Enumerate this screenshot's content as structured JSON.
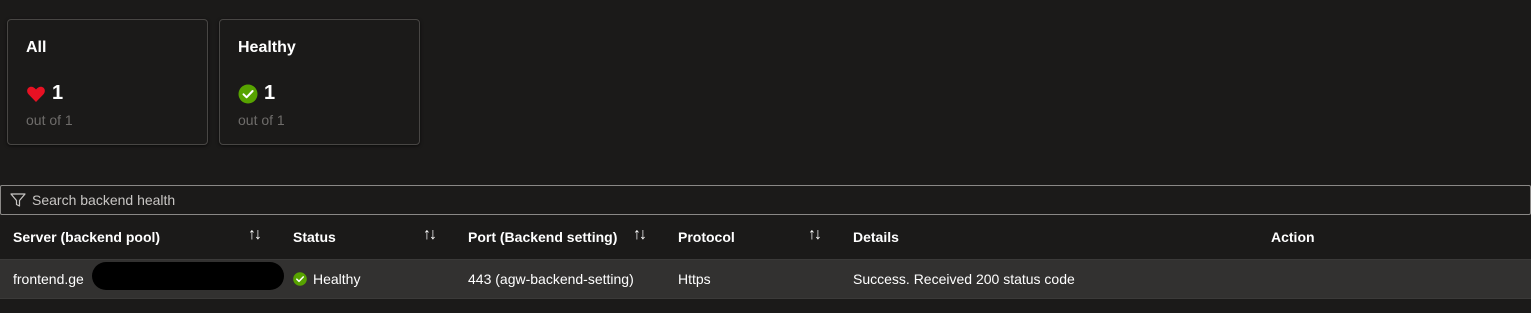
{
  "cards": [
    {
      "title": "All",
      "icon": "heart-icon",
      "count": "1",
      "sub": "out of 1"
    },
    {
      "title": "Healthy",
      "icon": "check-circle-icon",
      "count": "1",
      "sub": "out of 1"
    }
  ],
  "search": {
    "placeholder": "Search backend health",
    "value": ""
  },
  "table": {
    "headers": {
      "server": "Server (backend pool)",
      "status": "Status",
      "port": "Port (Backend setting)",
      "protocol": "Protocol",
      "details": "Details",
      "action": "Action"
    },
    "sort_glyph": "↑↓",
    "rows": [
      {
        "server": "frontend.ge",
        "status": "Healthy",
        "port": "443 (agw-backend-setting)",
        "protocol": "Https",
        "details": "Success. Received 200 status code",
        "action": ""
      }
    ]
  },
  "colors": {
    "background": "#1b1a19",
    "heart": "#e81123",
    "healthy": "#57a300",
    "row_background": "#323130"
  }
}
